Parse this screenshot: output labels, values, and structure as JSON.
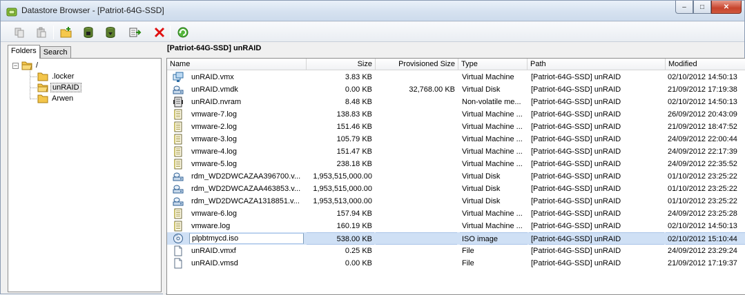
{
  "window": {
    "title": "Datastore Browser - [Patriot-64G-SSD]",
    "buttons": {
      "minimize": "–",
      "maximize": "□",
      "close": "✕"
    }
  },
  "toolbar": [
    {
      "name": "copy-file-button",
      "icon": "copy-icon"
    },
    {
      "name": "paste-file-button",
      "icon": "paste-icon"
    },
    {
      "name": "new-folder-button",
      "icon": "new-folder-icon"
    },
    {
      "name": "upload-button",
      "icon": "upload-datastore-icon"
    },
    {
      "name": "download-button",
      "icon": "download-datastore-icon"
    },
    {
      "name": "register-vm-button",
      "icon": "register-icon"
    },
    {
      "name": "delete-button",
      "icon": "delete-x-icon"
    },
    {
      "name": "refresh-button",
      "icon": "refresh-icon"
    }
  ],
  "left_tabs": {
    "folders": "Folders",
    "search": "Search"
  },
  "tree": {
    "root": "/",
    "children": [
      ".locker",
      "unRAID",
      "Arwen"
    ],
    "selected": "unRAID"
  },
  "current_path": "[Patriot-64G-SSD] unRAID",
  "columns": {
    "name": "Name",
    "size": "Size",
    "provisioned": "Provisioned Size",
    "type": "Type",
    "path": "Path",
    "modified": "Modified"
  },
  "files": [
    {
      "icon": "vmx-icon",
      "name": "unRAID.vmx",
      "size": "3.83 KB",
      "provisioned": "",
      "type": "Virtual Machine",
      "path": "[Patriot-64G-SSD] unRAID",
      "modified": "02/10/2012 14:50:13"
    },
    {
      "icon": "virtual-disk-icon",
      "name": "unRAID.vmdk",
      "size": "0.00 KB",
      "provisioned": "32,768.00 KB",
      "type": "Virtual Disk",
      "path": "[Patriot-64G-SSD] unRAID",
      "modified": "21/09/2012 17:19:38"
    },
    {
      "icon": "nvram-icon",
      "name": "unRAID.nvram",
      "size": "8.48 KB",
      "provisioned": "",
      "type": "Non-volatile me...",
      "path": "[Patriot-64G-SSD] unRAID",
      "modified": "02/10/2012 14:50:13"
    },
    {
      "icon": "log-icon",
      "name": "vmware-7.log",
      "size": "138.83 KB",
      "provisioned": "",
      "type": "Virtual Machine ...",
      "path": "[Patriot-64G-SSD] unRAID",
      "modified": "26/09/2012 20:43:09"
    },
    {
      "icon": "log-icon",
      "name": "vmware-2.log",
      "size": "151.46 KB",
      "provisioned": "",
      "type": "Virtual Machine ...",
      "path": "[Patriot-64G-SSD] unRAID",
      "modified": "21/09/2012 18:47:52"
    },
    {
      "icon": "log-icon",
      "name": "vmware-3.log",
      "size": "105.79 KB",
      "provisioned": "",
      "type": "Virtual Machine ...",
      "path": "[Patriot-64G-SSD] unRAID",
      "modified": "24/09/2012 22:00:44"
    },
    {
      "icon": "log-icon",
      "name": "vmware-4.log",
      "size": "151.47 KB",
      "provisioned": "",
      "type": "Virtual Machine ...",
      "path": "[Patriot-64G-SSD] unRAID",
      "modified": "24/09/2012 22:17:39"
    },
    {
      "icon": "log-icon",
      "name": "vmware-5.log",
      "size": "238.18 KB",
      "provisioned": "",
      "type": "Virtual Machine ...",
      "path": "[Patriot-64G-SSD] unRAID",
      "modified": "24/09/2012 22:35:52"
    },
    {
      "icon": "virtual-disk-icon",
      "name": "rdm_WD2DWCAZAA396700.v...",
      "size": "1,953,515,000.00",
      "provisioned": "",
      "type": "Virtual Disk",
      "path": "[Patriot-64G-SSD] unRAID",
      "modified": "01/10/2012 23:25:22"
    },
    {
      "icon": "virtual-disk-icon",
      "name": "rdm_WD2DWCAZAA463853.v...",
      "size": "1,953,515,000.00",
      "provisioned": "",
      "type": "Virtual Disk",
      "path": "[Patriot-64G-SSD] unRAID",
      "modified": "01/10/2012 23:25:22"
    },
    {
      "icon": "virtual-disk-icon",
      "name": "rdm_WD2DWCAZA1318851.v...",
      "size": "1,953,513,000.00",
      "provisioned": "",
      "type": "Virtual Disk",
      "path": "[Patriot-64G-SSD] unRAID",
      "modified": "01/10/2012 23:25:22"
    },
    {
      "icon": "log-icon",
      "name": "vmware-6.log",
      "size": "157.94 KB",
      "provisioned": "",
      "type": "Virtual Machine ...",
      "path": "[Patriot-64G-SSD] unRAID",
      "modified": "24/09/2012 23:25:28"
    },
    {
      "icon": "log-icon",
      "name": "vmware.log",
      "size": "160.19 KB",
      "provisioned": "",
      "type": "Virtual Machine ...",
      "path": "[Patriot-64G-SSD] unRAID",
      "modified": "02/10/2012 14:50:13"
    },
    {
      "icon": "iso-image-icon",
      "name": "plpbtmycd.iso",
      "size": "538.00 KB",
      "provisioned": "",
      "type": "ISO image",
      "path": "[Patriot-64G-SSD] unRAID",
      "modified": "02/10/2012 15:10:44",
      "selected": true
    },
    {
      "icon": "file-icon",
      "name": "unRAID.vmxf",
      "size": "0.25 KB",
      "provisioned": "",
      "type": "File",
      "path": "[Patriot-64G-SSD] unRAID",
      "modified": "24/09/2012 23:29:24"
    },
    {
      "icon": "file-icon",
      "name": "unRAID.vmsd",
      "size": "0.00 KB",
      "provisioned": "",
      "type": "File",
      "path": "[Patriot-64G-SSD] unRAID",
      "modified": "21/09/2012 17:19:37"
    }
  ]
}
